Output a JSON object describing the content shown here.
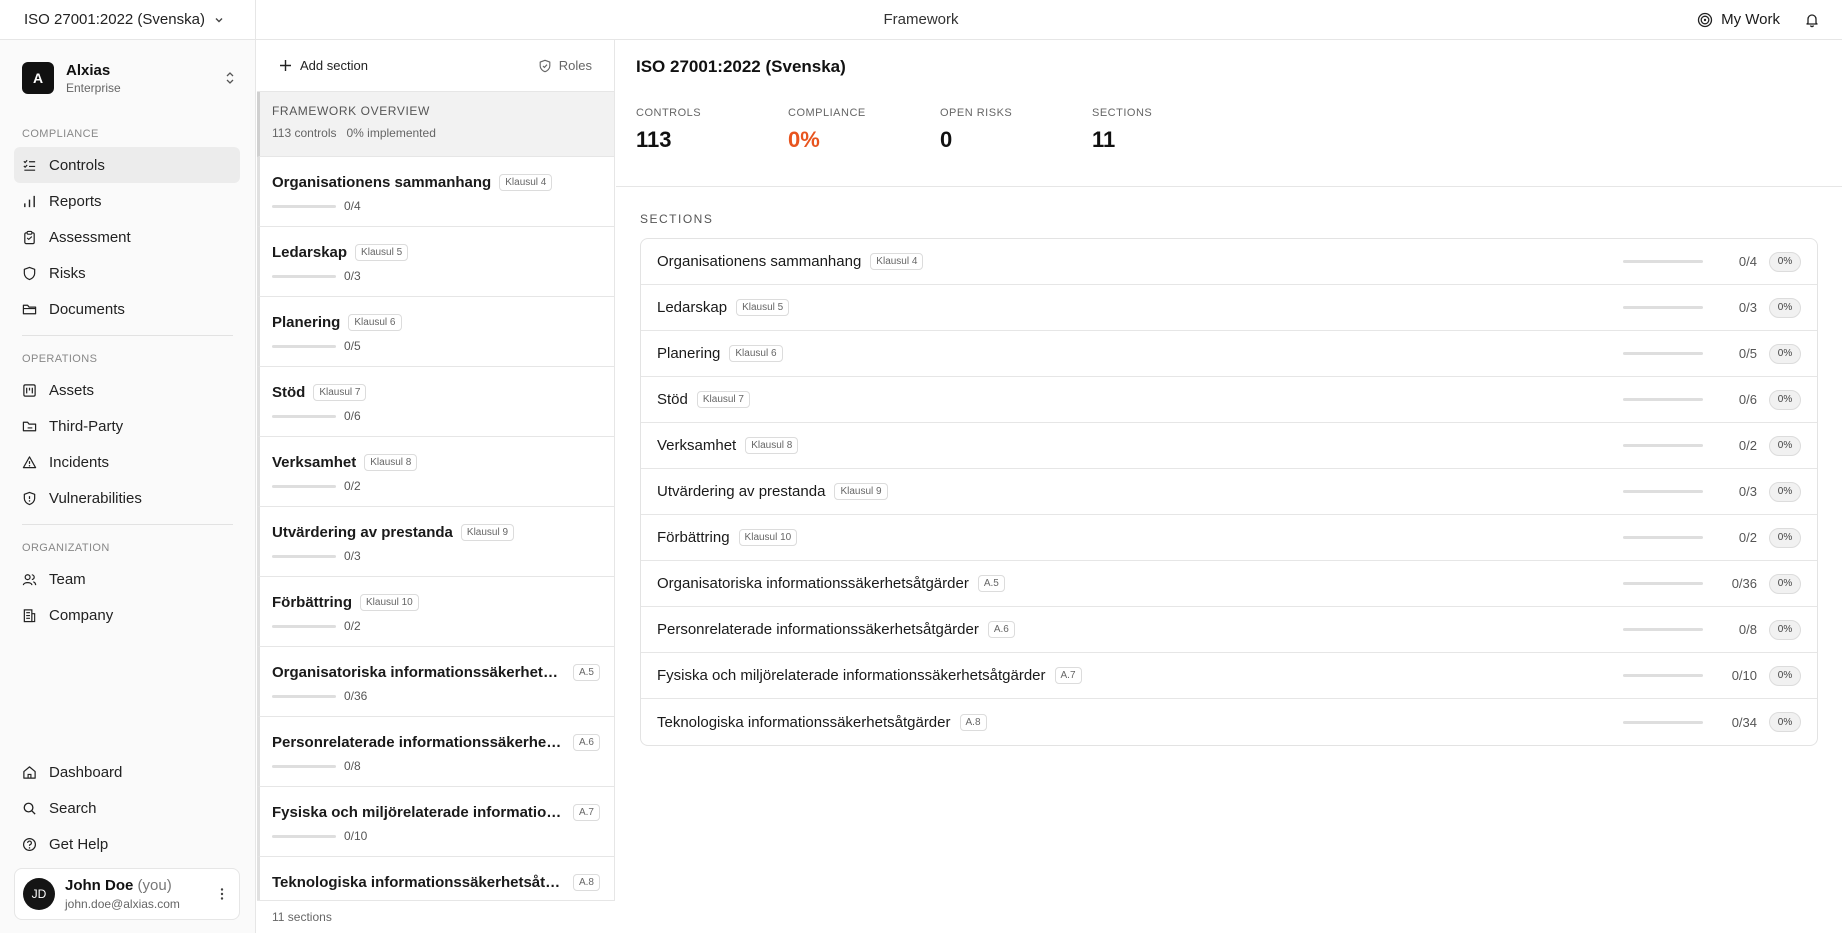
{
  "topbar": {
    "framework_select": "ISO 27001:2022 (Svenska)",
    "center_title": "Framework",
    "mywork_label": "My Work"
  },
  "org": {
    "initial": "A",
    "name": "Alxias",
    "plan": "Enterprise"
  },
  "sidebar": {
    "compliance_label": "COMPLIANCE",
    "compliance_items": [
      {
        "label": "Controls",
        "icon": "checklist-icon"
      },
      {
        "label": "Reports",
        "icon": "bar-chart-icon"
      },
      {
        "label": "Assessment",
        "icon": "clipboard-icon"
      },
      {
        "label": "Risks",
        "icon": "shield-icon"
      },
      {
        "label": "Documents",
        "icon": "folder-icon"
      }
    ],
    "operations_label": "OPERATIONS",
    "operations_items": [
      {
        "label": "Assets",
        "icon": "asset-icon"
      },
      {
        "label": "Third-Party",
        "icon": "folder-link-icon"
      },
      {
        "label": "Incidents",
        "icon": "warning-icon"
      },
      {
        "label": "Vulnerabilities",
        "icon": "shield-alert-icon"
      }
    ],
    "organization_label": "ORGANIZATION",
    "organization_items": [
      {
        "label": "Team",
        "icon": "users-icon"
      },
      {
        "label": "Company",
        "icon": "building-icon"
      }
    ],
    "bottom_items": [
      {
        "label": "Dashboard",
        "icon": "home-icon"
      },
      {
        "label": "Search",
        "icon": "search-icon"
      },
      {
        "label": "Get Help",
        "icon": "help-icon"
      }
    ]
  },
  "user": {
    "initials": "JD",
    "name": "John Doe",
    "you": "(you)",
    "email": "john.doe@alxias.com"
  },
  "middle": {
    "add_section_label": "Add section",
    "roles_label": "Roles",
    "overview_title": "FRAMEWORK OVERVIEW",
    "overview_controls": "113 controls",
    "overview_implemented": "0% implemented",
    "footer": "11 sections"
  },
  "main": {
    "title": "ISO 27001:2022 (Svenska)",
    "stats": [
      {
        "label": "CONTROLS",
        "value": "113"
      },
      {
        "label": "COMPLIANCE",
        "value": "0%"
      },
      {
        "label": "OPEN RISKS",
        "value": "0"
      },
      {
        "label": "SECTIONS",
        "value": "11"
      }
    ],
    "sections_label": "SECTIONS"
  },
  "sections": [
    {
      "title": "Organisationens sammanhang",
      "short_title": "Organisationens sammanhang",
      "badge": "Klausul 4",
      "count": "0/4",
      "pct": "0%",
      "progress": 0
    },
    {
      "title": "Ledarskap",
      "short_title": "Ledarskap",
      "badge": "Klausul 5",
      "count": "0/3",
      "pct": "0%",
      "progress": 0
    },
    {
      "title": "Planering",
      "short_title": "Planering",
      "badge": "Klausul 6",
      "count": "0/5",
      "pct": "0%",
      "progress": 0
    },
    {
      "title": "Stöd",
      "short_title": "Stöd",
      "badge": "Klausul 7",
      "count": "0/6",
      "pct": "0%",
      "progress": 0
    },
    {
      "title": "Verksamhet",
      "short_title": "Verksamhet",
      "badge": "Klausul 8",
      "count": "0/2",
      "pct": "0%",
      "progress": 0
    },
    {
      "title": "Utvärdering av prestanda",
      "short_title": "Utvärdering av prestanda",
      "badge": "Klausul 9",
      "count": "0/3",
      "pct": "0%",
      "progress": 0
    },
    {
      "title": "Förbättring",
      "short_title": "Förbättring",
      "badge": "Klausul 10",
      "count": "0/2",
      "pct": "0%",
      "progress": 0
    },
    {
      "title": "Organisatoriska informationssäkerhetsåtgärder",
      "short_title": "Organisatoriska informationssäkerhetsåt...",
      "badge": "A.5",
      "count": "0/36",
      "pct": "0%",
      "progress": 0
    },
    {
      "title": "Personrelaterade informationssäkerhetsåtgärder",
      "short_title": "Personrelaterade informationssäkerhetså...",
      "badge": "A.6",
      "count": "0/8",
      "pct": "0%",
      "progress": 0
    },
    {
      "title": "Fysiska och miljörelaterade informationssäkerhetsåtgärder",
      "short_title": "Fysiska och miljörelaterade informationss...",
      "badge": "A.7",
      "count": "0/10",
      "pct": "0%",
      "progress": 0
    },
    {
      "title": "Teknologiska informationssäkerhetsåtgärder",
      "short_title": "Teknologiska informationssäkerhetsåtgär...",
      "badge": "A.8",
      "count": "0/34",
      "pct": "0%",
      "progress": 0
    }
  ],
  "colors": {
    "accent_orange": "#e8541e",
    "active_bg": "#ececec"
  }
}
